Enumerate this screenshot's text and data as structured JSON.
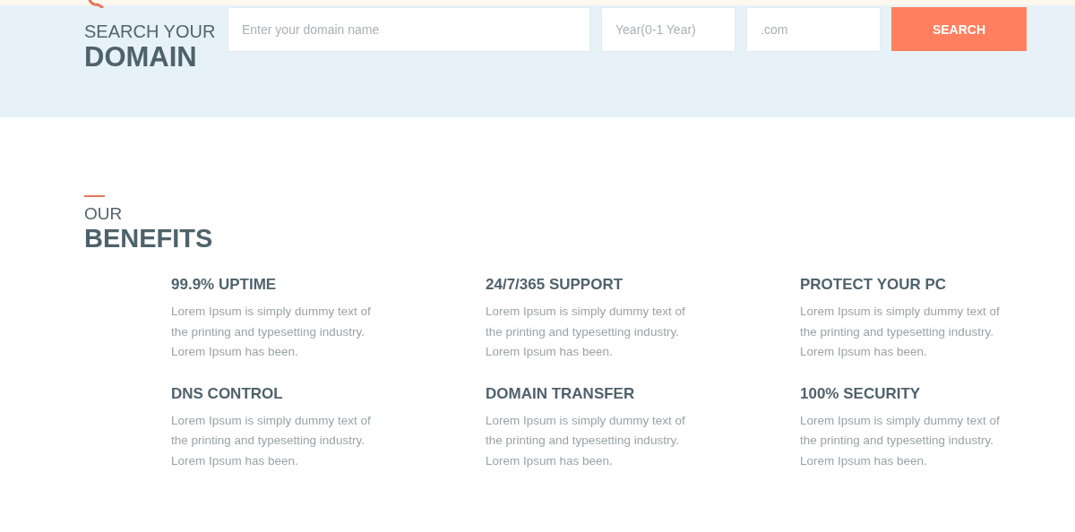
{
  "domain_search": {
    "heading_light": "SEARCH YOUR",
    "heading_bold": "DOMAIN",
    "domain_field": {
      "placeholder": "Enter your domain name"
    },
    "year_field": {
      "placeholder": "Year(0-1 Year)"
    },
    "extension_field": {
      "placeholder": ".com"
    },
    "button": "SEARCH"
  },
  "benefits": {
    "heading_light": "OUR",
    "heading_bold": "BENEFITS",
    "items": [
      {
        "title": "99.9% UPTIME",
        "text": "Lorem Ipsum is simply dummy text of the printing and typesetting industry. Lorem Ipsum has been."
      },
      {
        "title": "24/7/365 SUPPORT",
        "text": "Lorem Ipsum is simply dummy text of the printing and typesetting industry. Lorem Ipsum has been."
      },
      {
        "title": "PROTECT YOUR PC",
        "text": "Lorem Ipsum is simply dummy text of the printing and typesetting industry. Lorem Ipsum has been."
      },
      {
        "title": "DNS CONTROL",
        "text": "Lorem Ipsum is simply dummy text of the printing and typesetting industry. Lorem Ipsum has been."
      },
      {
        "title": "DOMAIN TRANSFER",
        "text": "Lorem Ipsum is simply dummy text of the printing and typesetting industry. Lorem Ipsum has been."
      },
      {
        "title": "100% SECURITY",
        "text": "Lorem Ipsum is simply dummy text of the printing and typesetting industry. Lorem Ipsum has been."
      }
    ]
  }
}
